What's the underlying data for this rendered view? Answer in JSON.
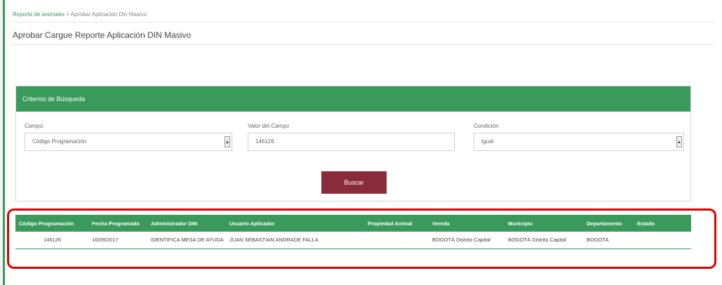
{
  "breadcrumb": {
    "link": "Reporte de animales",
    "separator": " > ",
    "current": "Aprobar Aplicación Din Masivo"
  },
  "page_title": "Aprobar Cargue Reporte Aplicación DIN Masivo",
  "search": {
    "header": "Criterios de Búsqueda",
    "campo_label": "Campo:",
    "campo_value": "Código Programación",
    "valor_label": "Valor del Campo",
    "valor_value": "146126",
    "condicion_label": "Condición",
    "condicion_value": "Igual",
    "button_label": "Buscar"
  },
  "table": {
    "columns": [
      "Código Programación",
      "Fecha Programada",
      "Administrador DIN",
      "Usuario Aplicador",
      "Propiedad Animal",
      "Vereda",
      "Municipio",
      "Departamento",
      "Estado"
    ],
    "rows": [
      [
        "146126",
        "16/09/2017",
        "IDENTIFICA MESA DE AYUDA",
        "JUAN SEBASTIAN ANDRADE FALLA",
        "",
        "BOGOTÁ Distrito Capital",
        "BOGOTÁ Distrito Capital",
        "BOGOTA",
        ""
      ]
    ]
  },
  "colors": {
    "accent_green": "#3a9a5c",
    "button_maroon": "#8a2b3a",
    "highlight_red": "#e00000"
  }
}
